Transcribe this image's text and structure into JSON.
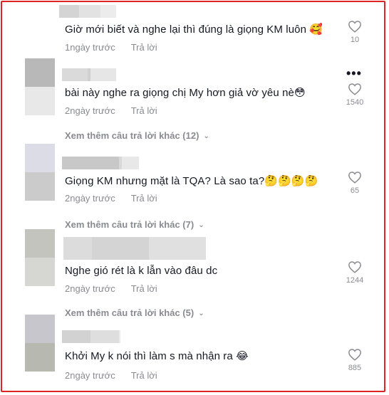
{
  "comments": [
    {
      "text": "Giờ mới biết và nghe lại thì đúng là giọng KM luôn",
      "emoji": "🥰",
      "time": "1ngày trước",
      "reply": "Trả lời",
      "likes": "10",
      "avatar_colors": [
        "#cfcfd4",
        "#ffffff"
      ],
      "name_blur": [
        "#d4d4d4",
        "#e2e2e2",
        "#ececec"
      ]
    },
    {
      "text": "bài này nghe ra giọng chị My hơn giả vờ yêu nè",
      "emoji": "😳",
      "time": "2ngày trước",
      "reply": "Trả lời",
      "likes": "1540",
      "avatar_colors": [
        "#b8b8b8",
        "#e8e8e8"
      ],
      "name_blur": [
        "#dadada",
        "#d0d0d0",
        "#e6e6e6"
      ],
      "more": "•••"
    },
    {
      "text": "Giọng KM nhưng mặt là TQA? Là sao ta?",
      "emoji": "🤔🤔🤔🤔",
      "time": "2ngày trước",
      "reply": "Trả lời",
      "likes": "65",
      "avatar_colors": [
        "#dcdce6",
        "#cbcbcb"
      ],
      "name_blur": [
        "#c8c8c8",
        "#d8d8d8",
        "#e8e8e8"
      ]
    },
    {
      "text": "Nghe gió rét là k lẫn vào đâu dc",
      "emoji": "",
      "time": "2ngày trước",
      "reply": "Trả lời",
      "likes": "1244",
      "avatar_colors": [
        "#c4c4bf",
        "#d6d6d3"
      ],
      "name_blur": [
        "#dcdcdc",
        "#d4d4d4",
        "#e0e0e0"
      ]
    },
    {
      "text": "Khởi My k nói thì làm s mà nhận ra",
      "emoji": "😂",
      "time": "2ngày trước",
      "reply": "Trả lời",
      "likes": "885",
      "avatar_colors": [
        "#c6c6cc",
        "#b7b9b0"
      ],
      "name_blur": [
        "#d2d2d2",
        "#dedede",
        "#ebebeb"
      ]
    }
  ],
  "view_more": [
    "Xem thêm câu trả lời khác (12)",
    "Xem thêm câu trả lời khác (7)",
    "Xem thêm câu trả lời khác (5)"
  ],
  "colors": {
    "frame_border": "#e02424",
    "text": "#161823",
    "secondary": "#8a8b91"
  }
}
